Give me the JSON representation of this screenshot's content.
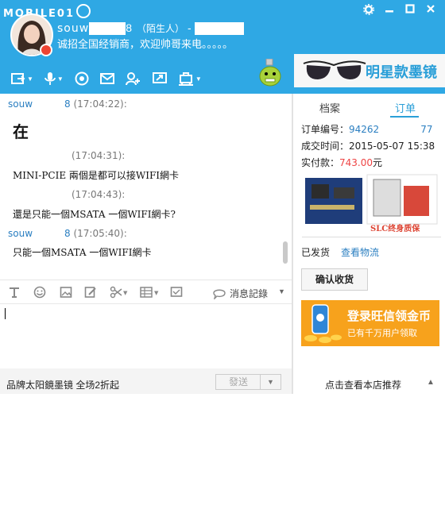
{
  "header": {
    "logo_text": "MOBILE01",
    "user_name": "souw",
    "user_name_suffix": "8",
    "relation": "（陌生人）",
    "dash": "-",
    "signature": "诚招全国经销商，欢迎帅哥来电。。。。。",
    "accent_color": "#2fa8e4"
  },
  "window_controls": {
    "settings_icon": "gear-icon",
    "minimize_icon": "minimize-icon",
    "maximize_icon": "maximize-icon",
    "close_icon": "close-icon"
  },
  "toolbar_icons": [
    "file-transfer-icon",
    "voice-icon",
    "video-icon",
    "mail-icon",
    "add-contact-icon",
    "share-screen-icon",
    "remote-assist-icon"
  ],
  "ad_banner": {
    "text": "明星款墨镜"
  },
  "chat": {
    "messages": [
      {
        "sender": "souw",
        "sender_suffix": "8",
        "time": "(17:04:22):",
        "text": "在"
      },
      {
        "sender": "",
        "sender_suffix": "",
        "time": "(17:04:31):",
        "text": "MINI-PCIE 兩個是都可以接WIFI網卡"
      },
      {
        "sender": "",
        "sender_suffix": "",
        "time": "(17:04:43):",
        "text": "還是只能一個MSATA 一個WIFI網卡?"
      },
      {
        "sender": "souw",
        "sender_suffix": "8",
        "time": "(17:05:40):",
        "text": "只能一個MSATA 一個WIFI網卡"
      }
    ]
  },
  "input_toolbar": {
    "icons": [
      "font-icon",
      "emoji-icon",
      "image-icon",
      "edit-icon",
      "scissors-icon",
      "table-icon",
      "screenshot-icon"
    ],
    "history_label": "消息記錄"
  },
  "input": {
    "value": ""
  },
  "bottom": {
    "promo": "品牌太阳鏡墨镜  全场2折起",
    "send_label": "發送"
  },
  "right_panel": {
    "tabs": [
      "档案",
      "订单"
    ],
    "active_tab": "订单",
    "order_no_label": "订单编号：",
    "order_no_a": "94262",
    "order_no_b": "77",
    "deal_time_label": "成交时间：",
    "deal_time": "2015-05-07 15:38",
    "paid_label": "实付款：",
    "paid_amount": "743.00",
    "paid_unit": "元",
    "product_caption": "SLC终身质保",
    "status": "已发货",
    "logistics_link": "查看物流",
    "confirm_button": "确认收货",
    "wangxin_ad_line1": "登录旺信领金币",
    "wangxin_ad_line2": "已有千万用户领取",
    "recommend": "点击查看本店推荐"
  }
}
